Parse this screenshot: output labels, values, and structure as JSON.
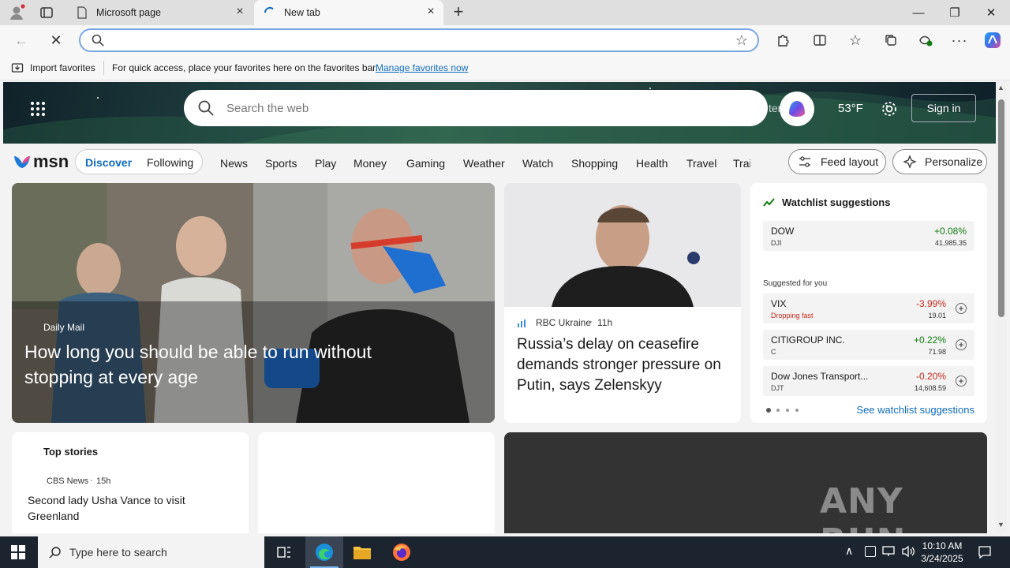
{
  "browser": {
    "tabs": [
      {
        "title": "Microsoft page"
      },
      {
        "title": "New tab"
      }
    ],
    "address_value": "",
    "favorites_bar": {
      "import_label": "Import favorites",
      "message": "For quick access, place your favorites here on the favorites bar.",
      "manage_link": "Manage favorites now"
    }
  },
  "msn": {
    "search_placeholder": "Search the web",
    "partial_overlap_text": "ter lam",
    "weather_temp": "53°F",
    "sign_in": "Sign in",
    "logo_text": "msn",
    "nav": {
      "discover": "Discover",
      "following": "Following",
      "items": [
        "News",
        "Sports",
        "Play",
        "Money",
        "Gaming",
        "Weather",
        "Watch",
        "Shopping",
        "Health",
        "Travel",
        "Trai"
      ]
    },
    "feed_layout": "Feed layout",
    "personalize": "Personalize",
    "hero_story": {
      "source": "Daily Mail",
      "title": "How long you should be able to run without stopping at every age"
    },
    "side_story": {
      "source": "RBC Ukraine",
      "age": "11h",
      "title": "Russia’s delay on ceasefire demands stronger pressure on Putin, says Zelenskyy"
    },
    "watchlist": {
      "title": "Watchlist suggestions",
      "main": {
        "name": "DOW",
        "symbol": "DJI",
        "change": "+0.08%",
        "price": "41,985.35"
      },
      "suggested_label": "Suggested for you",
      "suggestions": [
        {
          "name": "VIX",
          "sub": "Dropping fast",
          "change": "-3.99%",
          "price": "19.01"
        },
        {
          "name": "CITIGROUP INC.",
          "sub": "C",
          "change": "+0.22%",
          "price": "71.98"
        },
        {
          "name": "Dow Jones Transport...",
          "sub": "DJT",
          "change": "-0.20%",
          "price": "14,608.59"
        }
      ],
      "see_link": "See watchlist suggestions"
    },
    "top_stories": {
      "title": "Top stories",
      "source": "CBS News",
      "age": "15h",
      "headline": "Second lady Usha Vance to visit Greenland"
    },
    "watermark": "ANY RUN"
  },
  "taskbar": {
    "search_placeholder": "Type here to search",
    "time": "10:10 AM",
    "date": "3/24/2025"
  },
  "colors": {
    "accent": "#0f6cbd",
    "positive": "#107c10",
    "negative": "#c42b1c",
    "taskbar": "#1c2430"
  }
}
